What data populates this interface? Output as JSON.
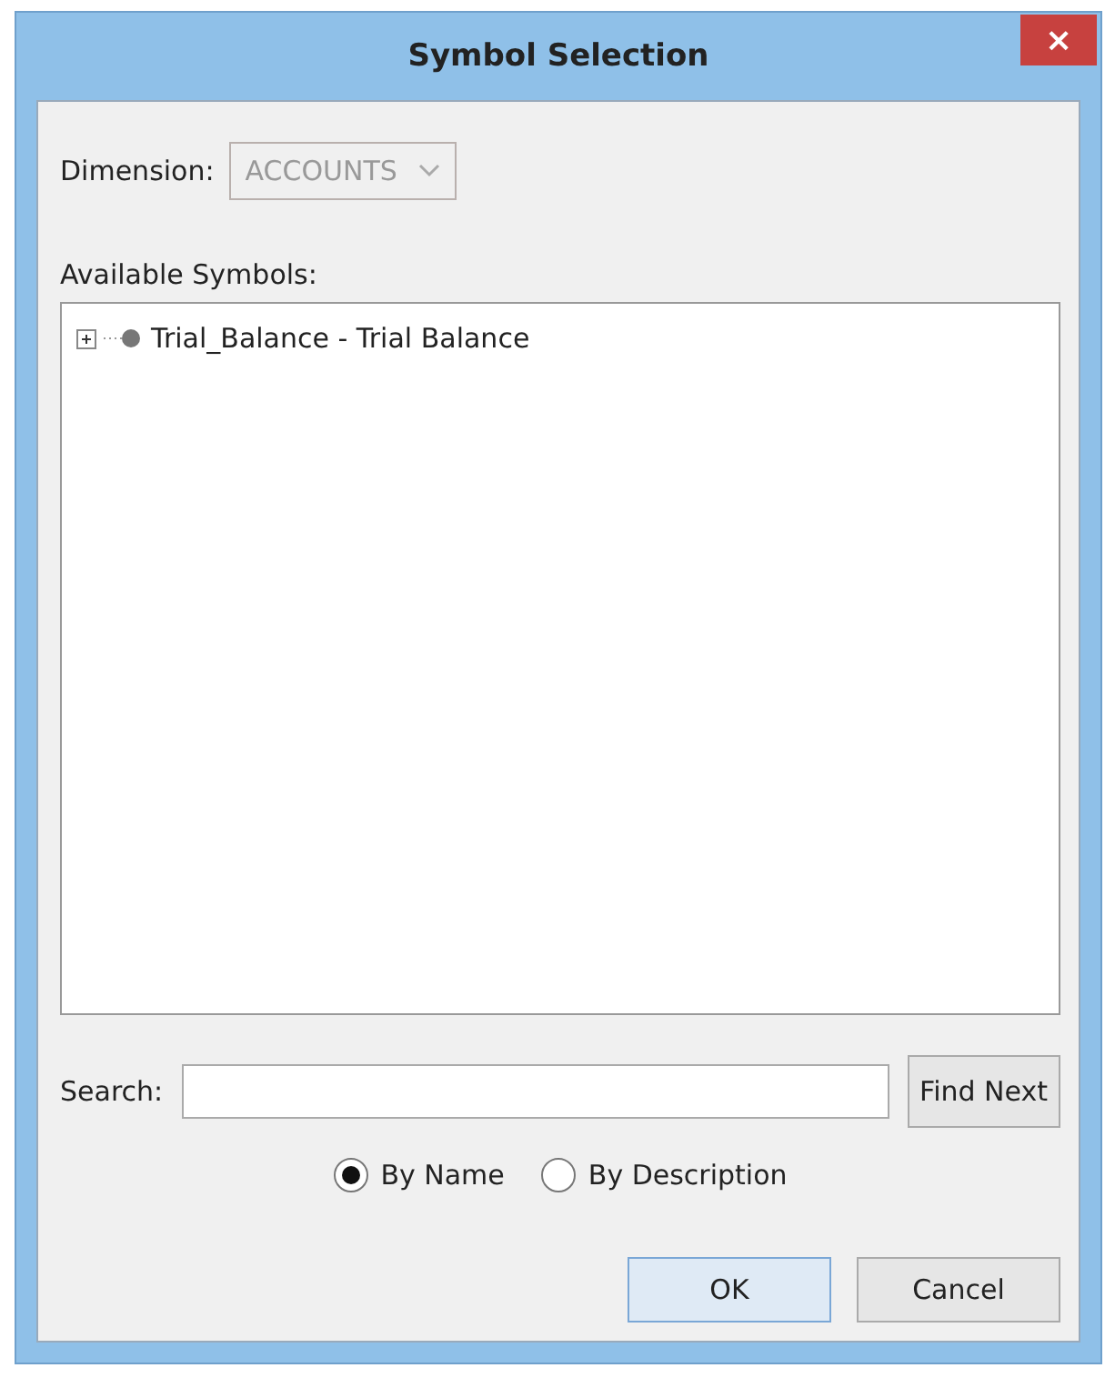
{
  "window": {
    "title": "Symbol Selection",
    "close": "×"
  },
  "dimension": {
    "label": "Dimension:",
    "value": "ACCOUNTS",
    "disabled": true
  },
  "symbols": {
    "label": "Available Symbols:",
    "items": [
      {
        "label": "Trial_Balance - Trial Balance",
        "expanded": false
      }
    ]
  },
  "search": {
    "label": "Search:",
    "button": "Find Next"
  },
  "options": [
    {
      "label": "By Name",
      "selected": true
    },
    {
      "label": "By Description",
      "selected": false
    }
  ],
  "buttons": [
    {
      "label": "OK",
      "kind": "default"
    },
    {
      "label": "Cancel",
      "kind": "normal"
    }
  ]
}
